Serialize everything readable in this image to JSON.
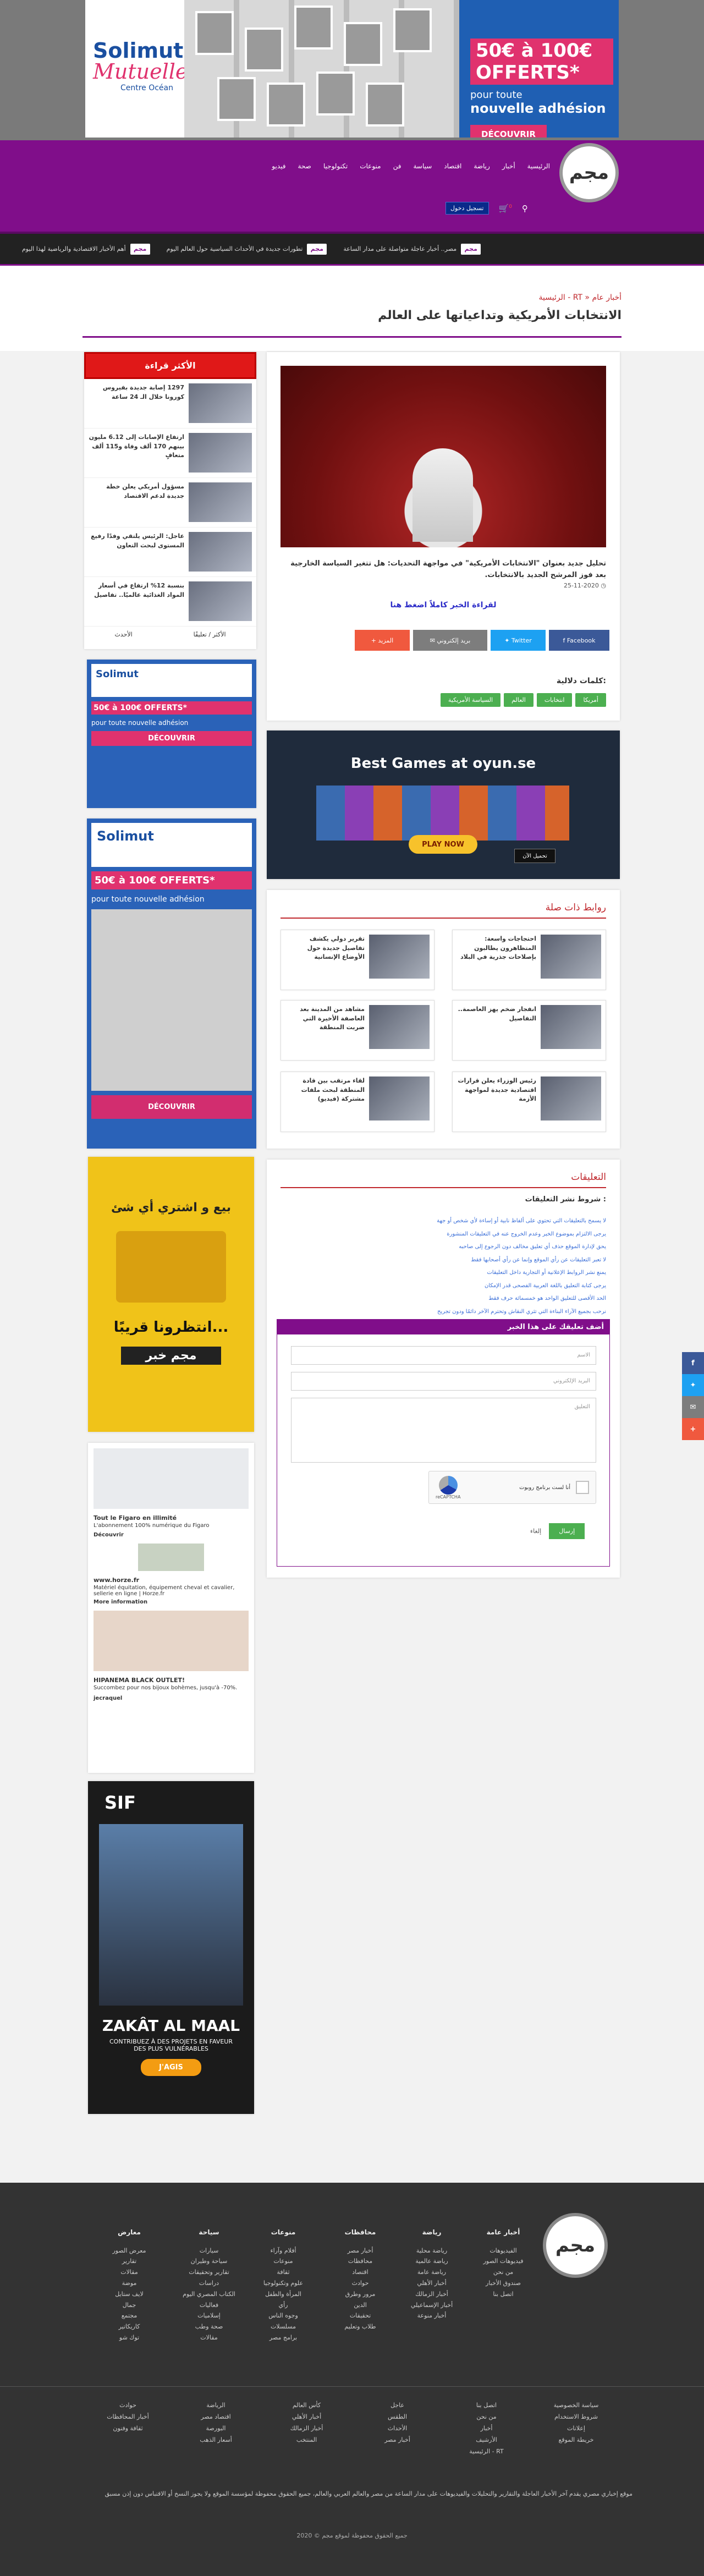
{
  "top_ad": {
    "brand_line1": "Solimut",
    "brand_line2": "Mutuelle",
    "brand_line3": "Centre Océan",
    "offer": "50€ à 100€ OFFERTS*",
    "offer_sub": "pour toute",
    "offer_sub2": "nouvelle adhésion",
    "cta": "DÉCOUVRIR"
  },
  "nav": {
    "logo": "مجم",
    "menu": [
      "الرئيسية",
      "أخبار",
      "رياضة",
      "اقتصاد",
      "سياسة",
      "فن",
      "منوعات",
      "تكنولوجيا",
      "صحة",
      "فيديو"
    ],
    "login": "تسجيل دخول",
    "cart_count": "0"
  },
  "ticker": [
    "مصر.. أخبار عاجلة متواصلة على مدار الساعة",
    "تطورات جديدة في الأحداث السياسية حول العالم اليوم",
    "أهم الأخبار الاقتصادية والرياضية لهذا اليوم"
  ],
  "breadcrumb": "الرئيسية - RT » أخبار عام",
  "page_title": "الانتخابات الأمريكية وتداعياتها على العالم",
  "sidebar": {
    "head": "الأكثر قراءة",
    "items": [
      "1297 إصابة جديدة بفيروس كورونا خلال الـ 24 ساعة",
      "ارتفاع الإصابات إلى 6.12 مليون بينهم 170 ألف وفاة و115 ألف متعافٍ",
      "مسؤول أمريكي يعلن خطة جديدة لدعم الاقتصاد",
      "عاجل: الرئيس يلتقي وفدًا رفيع المستوى لبحث التعاون",
      "بنسبة 12% ارتفاع في أسعار المواد الغذائية عالميًا.. تفاصيل"
    ],
    "foot_a": "الأحدث",
    "foot_b": "الأكثر / تعليقًا"
  },
  "side_ad1": {
    "brand": "Solimut",
    "offer": "50€ à 100€ OFFERTS*",
    "sub": "pour toute nouvelle adhésion",
    "cta": "DÉCOUVRIR"
  },
  "side_ad2": {
    "brand": "Solimut",
    "offer": "50€ à 100€ OFFERTS*",
    "sub": "pour toute nouvelle adhésion",
    "cta": "DÉCOUVRIR"
  },
  "side_ad3": {
    "line1": "بيع و اشتري أي شئ",
    "line2": "انتظرونا قريبًا...",
    "line3": "مجم خبر"
  },
  "side_ad4": {
    "a_title": "Tout le Figaro en illimité",
    "a_sub": "L'abonnement 100% numérique du Figaro",
    "a_link": "Découvrir",
    "b_site": "www.horze.fr",
    "b_text": "Matériel équitation, équipement cheval et cavalier, sellerie en ligne | Horze.fr",
    "b_link": "More information",
    "c_title": "HIPANEMA BLACK OUTLET!",
    "c_text": "Succombez pour nos bijoux bohèmes, jusqu'à -70%.",
    "c_src": "jecraquel"
  },
  "side_ad5": {
    "logo": "SIF",
    "title": "ZAKÂT AL MAAL",
    "sub": "CONTRIBUEZ À DES PROJETS EN FAVEUR DES PLUS VULNÉRABLES",
    "cta": "J'AGIS"
  },
  "article": {
    "lead": "تحليل جديد بعنوان \"الانتخابات الأمريكية\" في مواجهة التحديات: هل تتغير السياسة الخارجية بعد فوز المرشح الجديد بالانتخابات.",
    "date": "25-11-2020",
    "read_more": "لقراءة الخبر كاملاً اضغط هنا",
    "share": {
      "facebook": "Facebook",
      "twitter": "Twitter",
      "email": "بريد إلكتروني",
      "more": "المزيد"
    },
    "tags_label": "كلمات دلالية:",
    "tags": [
      "أمريكا",
      "انتخابات",
      "العالم",
      "السياسة الأمريكية"
    ]
  },
  "mid_ad": {
    "title": "Best Games at oyun.se",
    "play": "PLAY NOW",
    "action": "تحميل الآن"
  },
  "related": {
    "head": "روابط ذات صلة",
    "items": [
      "احتجاجات واسعة: المتظاهرون يطالبون بإصلاحات جذرية في البلاد",
      "تقرير دولي يكشف تفاصيل جديدة حول الأوضاع الإنسانية",
      "انفجار ضخم يهز العاصمة.. التفاصيل",
      "مشاهد من المدينة بعد العاصفة الأخيرة التي ضربت المنطقة",
      "رئيس الوزراء يعلن قرارات اقتصادية جديدة لمواجهة الأزمة",
      "لقاء مرتقب بين قادة المنطقة لبحث ملفات مشتركة (فيديو)"
    ]
  },
  "comments": {
    "head": "التعليقات",
    "sub": "شروط نشر التعليقات :",
    "rules": [
      "لا يسمح بالتعليقات التي تحتوي على ألفاظ نابية أو إساءة لأي شخص أو جهة",
      "يرجى الالتزام بموضوع الخبر وعدم الخروج عنه في التعليقات المنشورة",
      "يحق لإدارة الموقع حذف أي تعليق مخالف دون الرجوع إلى صاحبه",
      "لا تعبر التعليقات عن رأي الموقع وإنما عن رأي أصحابها فقط",
      "يمنع نشر الروابط الإعلانية أو التجارية داخل التعليقات",
      "يرجى كتابة التعليق باللغة العربية الفصحى قدر الإمكان",
      "الحد الأقصى للتعليق الواحد هو خمسمائة حرف فقط",
      "نرحب بجميع الآراء البناءة التي تثري النقاش وتحترم الآخر دائمًا ودون تجريح"
    ],
    "form_title": "أضف تعليقك على هذا الخبر",
    "name_ph": "الاسم",
    "email_ph": "البريد الإلكتروني",
    "comment_ph": "التعليق",
    "recaptcha_label": "أنا لست برنامج روبوت",
    "recaptcha_brand": "reCAPTCHA",
    "send": "إرسال",
    "cancel": "إلغاء"
  },
  "footer": {
    "logo": "مجم",
    "columns": [
      {
        "h": "أخبار عامة",
        "items": [
          "الفيديوهات",
          "فيديوهات الصور",
          "من نحن",
          "صندوق الأخبار",
          "اتصل بنا"
        ]
      },
      {
        "h": "رياضة",
        "items": [
          "رياضة محلية",
          "رياضة عالمية",
          "رياضة عامة",
          "أخبار الأهلي",
          "أخبار الزمالك",
          "أخبار الإسماعيلي",
          "أخبار منوعة"
        ]
      },
      {
        "h": "محافظات",
        "items": [
          "أخبار مصر",
          "محافظات",
          "اقتصاد",
          "حوادث",
          "مرور وطرق",
          "الدين",
          "تحقيقات",
          "طلاب وتعليم"
        ]
      },
      {
        "h": "منوعات",
        "items": [
          "أفلام وآراء",
          "منوعات",
          "ثقافة",
          "علوم وتكنولوجيا",
          "المرأة والطفل",
          "رأي",
          "وجوه الناس",
          "مسلسلات",
          "برامج مصر"
        ]
      },
      {
        "h": "سياحة",
        "items": [
          "سيارات",
          "سياحة وطيران",
          "تقارير وتحقيقات",
          "دراسات",
          "الكتاب المصري اليوم",
          "فعاليات",
          "إسلاميات",
          "صحة وطب",
          "مقالات"
        ]
      },
      {
        "h": "معارض",
        "items": [
          "معرض الصور",
          "تقارير",
          "مقالات",
          "موضة",
          "لايف ستايل",
          "جمال",
          "مجتمع",
          "كاريكاتير",
          "توك شو"
        ]
      }
    ],
    "links": [
      [
        "سياسة الخصوصية",
        "شروط الاستخدام",
        "إعلانات",
        "خريطة الموقع"
      ],
      [
        "اتصل بنا",
        "من نحن",
        "أخبار",
        "الأرشيف",
        "الرئيسية - RT"
      ],
      [
        "عاجل",
        "الطقس",
        "الأحداث",
        "أخبار مصر"
      ],
      [
        "كأس العالم",
        "أخبار الأهلي",
        "أخبار الزمالك",
        "المنتخب"
      ],
      [
        "الرياضة",
        "اقتصاد مصر",
        "البورصة",
        "أسعار الذهب"
      ],
      [
        "حوادث",
        "أخبار المحافظات",
        "ثقافة وفنون"
      ]
    ],
    "about": "موقع إخباري مصري يقدم آخر الأخبار العاجلة والتقارير والتحليلات والفيديوهات على مدار الساعة من مصر والعالم العربي والعالم، جميع الحقوق محفوظة لمؤسسة الموقع ولا يجوز النسخ أو الاقتباس دون إذن مسبق",
    "copyright": "2020 © جميع الحقوق محفوظة لموقع مجم"
  }
}
